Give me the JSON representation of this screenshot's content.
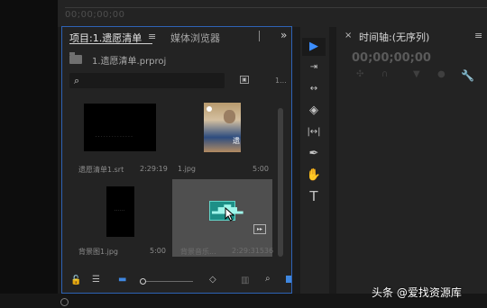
{
  "top_bar": {
    "timecode": "00;00;00;00"
  },
  "project_panel": {
    "tab_project": "项目:1.遗愿清单",
    "tab_project_menu": "≡",
    "tab_media_browser": "媒体浏览器",
    "more_icon": "»",
    "project_file": "1.遗愿清单.prproj",
    "search_placeholder": "",
    "search_icon": "⌕",
    "new_bin_icon": "▣",
    "page_indicator": "1...",
    "items": [
      {
        "name": "遗愿清单1.srt",
        "duration": "2:29:19",
        "thumb_text": "- - - - - - - - - - - - - -"
      },
      {
        "name": "1.jpg",
        "duration": "5:00",
        "thumb_text": "遗"
      },
      {
        "name": "背景图1.jpg",
        "duration": "5:00",
        "thumb_text": "- - - - - -"
      },
      {
        "name": "背景音乐...",
        "duration": "2:29:31536",
        "badge": "▸▸"
      }
    ],
    "bottom_bar": {
      "lock_icon": "🔓",
      "list_view_icon": "☰",
      "icon_view_icon": "▬",
      "sort_icon": "◇",
      "automate_icon": "▥",
      "find_icon": "⌕"
    }
  },
  "tools": {
    "select": "▶",
    "track_select": "⇥",
    "ripple": "↔",
    "razor": "◈",
    "slip": "|↔|",
    "pen": "✒",
    "hand": "✋",
    "type": "T"
  },
  "timeline": {
    "close_icon": "×",
    "title": "时间轴:(无序列)",
    "menu_icon": "≡",
    "timecode": "00;00;00;00",
    "icons": {
      "snap": "✣",
      "link": "∩",
      "add_marker": "▼",
      "marker": "●",
      "settings": "🔧"
    }
  },
  "watermark": "头条 @爱找资源库",
  "colors": {
    "panel_border": "#2e63b5",
    "accent_blue": "#3c8eff",
    "audio_clip": "#1d8f87"
  }
}
